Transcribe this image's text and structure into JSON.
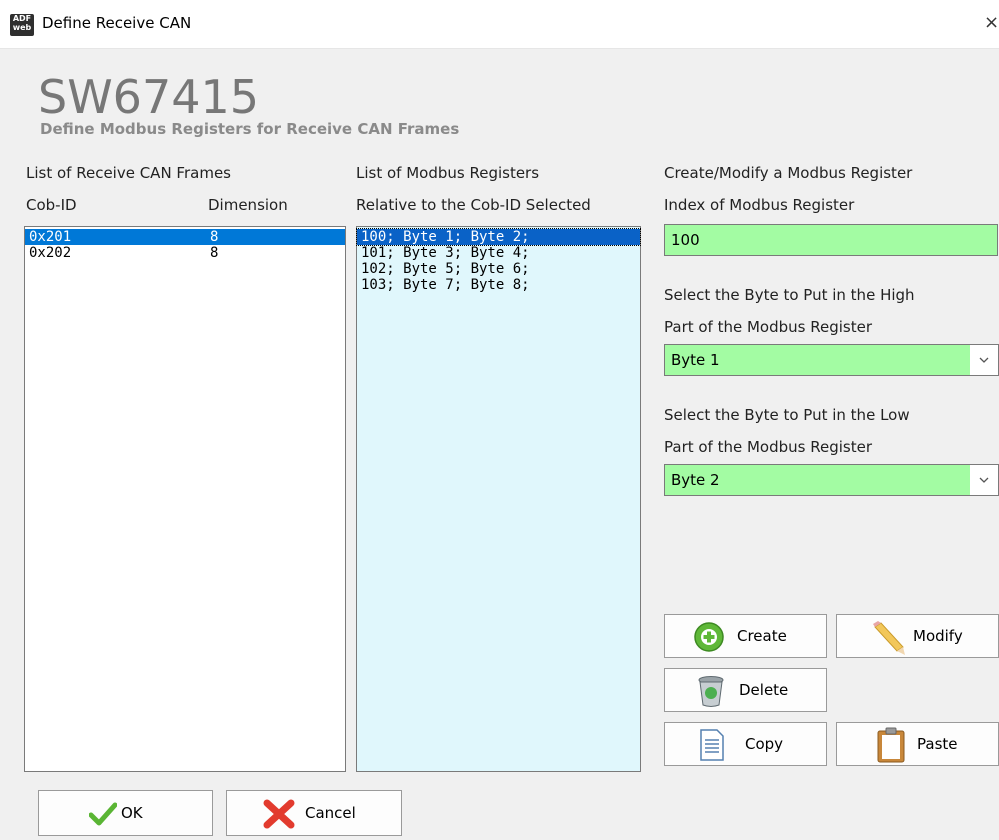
{
  "window": {
    "icon_text": "ADF web",
    "title": "Define Receive CAN",
    "close_glyph": "×"
  },
  "header": {
    "title": "SW67415",
    "subtitle": "Define Modbus Registers for Receive CAN Frames"
  },
  "frames": {
    "heading": "List of Receive CAN Frames",
    "col_cobid": "Cob-ID",
    "col_dimension": "Dimension",
    "rows": [
      {
        "cobid": "0x201",
        "dimension": "8",
        "selected": true
      },
      {
        "cobid": "0x202",
        "dimension": "8",
        "selected": false
      }
    ]
  },
  "registers": {
    "heading": "List of Modbus Registers",
    "subheading": "Relative to the Cob-ID Selected",
    "items": [
      {
        "text": "100; Byte 1; Byte 2;",
        "selected": true
      },
      {
        "text": "101; Byte 3; Byte 4;",
        "selected": false
      },
      {
        "text": "102; Byte 5; Byte 6;",
        "selected": false
      },
      {
        "text": "103; Byte 7; Byte 8;",
        "selected": false
      }
    ]
  },
  "editor": {
    "heading": "Create/Modify a Modbus Register",
    "index_label": "Index of Modbus Register",
    "index_value": "100",
    "high_label_1": "Select the Byte to Put in the High",
    "high_label_2": "Part of the Modbus Register",
    "high_value": "Byte 1",
    "low_label_1": "Select the Byte to Put in the Low",
    "low_label_2": "Part of the Modbus Register",
    "low_value": "Byte 2",
    "field_color": "#a3fca3"
  },
  "actions": {
    "create": "Create",
    "modify": "Modify",
    "delete": "Delete",
    "copy": "Copy",
    "paste": "Paste"
  },
  "footer": {
    "ok": "OK",
    "cancel": "Cancel"
  },
  "colors": {
    "selection": "#0078d7",
    "register_list_bg": "#e0f7fc"
  }
}
